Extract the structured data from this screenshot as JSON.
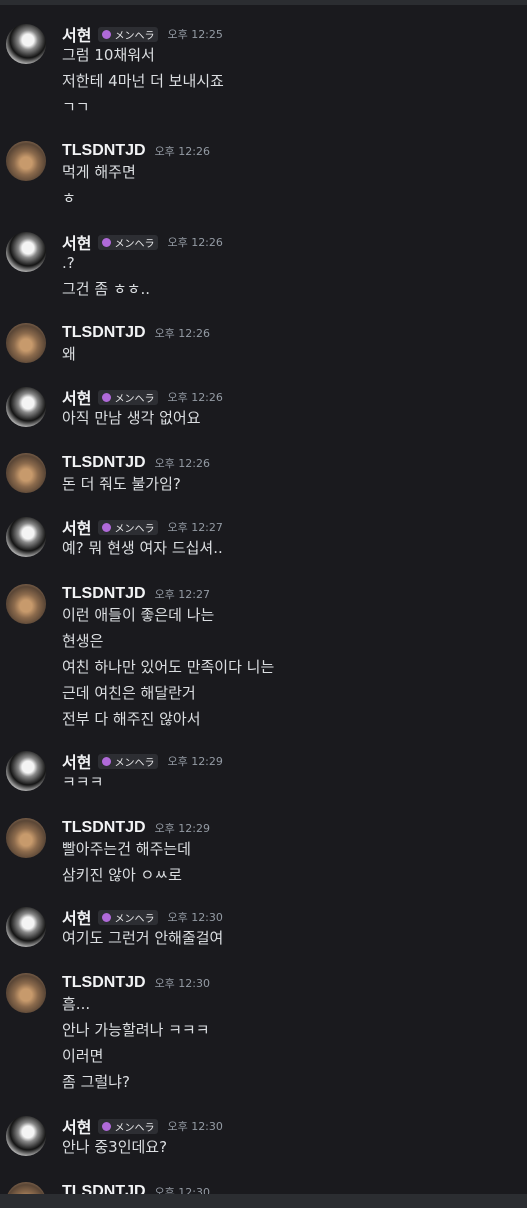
{
  "messages": [
    {
      "author": "서현",
      "tag": "メンヘラ",
      "time": "오후 12:25",
      "lines": [
        "그럼 10채워서",
        "저한테 4마넌 더 보내시죠",
        "ㄱㄱ"
      ]
    },
    {
      "author": "TLSDNTJD",
      "time": "오후 12:26",
      "lines": [
        "먹게 해주면",
        "ㅎ"
      ]
    },
    {
      "author": "서현",
      "tag": "メンヘラ",
      "time": "오후 12:26",
      "lines": [
        ".?",
        "그건 좀 ㅎㅎ.."
      ]
    },
    {
      "author": "TLSDNTJD",
      "time": "오후 12:26",
      "lines": [
        "왜"
      ]
    },
    {
      "author": "서현",
      "tag": "メンヘラ",
      "time": "오후 12:26",
      "lines": [
        "아직 만남 생각 없어요"
      ]
    },
    {
      "author": "TLSDNTJD",
      "time": "오후 12:26",
      "lines": [
        "돈 더 줘도 불가임?"
      ]
    },
    {
      "author": "서현",
      "tag": "メンヘラ",
      "time": "오후 12:27",
      "lines": [
        "예? 뭐 현생 여자 드십셔.."
      ]
    },
    {
      "author": "TLSDNTJD",
      "time": "오후 12:27",
      "lines": [
        "이런 애들이 좋은데 나는",
        "현생은",
        "여친 하나만 있어도 만족이다 니는",
        "근데 여친은 해달란거",
        "전부 다 해주진 않아서"
      ]
    },
    {
      "author": "서현",
      "tag": "メンヘラ",
      "time": "오후 12:29",
      "lines": [
        "ㅋㅋㅋ"
      ]
    },
    {
      "author": "TLSDNTJD",
      "time": "오후 12:29",
      "lines": [
        "빨아주는건 해주는데",
        "삼키진 않아 ㅇㅆ로"
      ]
    },
    {
      "author": "서현",
      "tag": "メンヘラ",
      "time": "오후 12:30",
      "lines": [
        "여기도 그런거 안해줄걸여"
      ]
    },
    {
      "author": "TLSDNTJD",
      "time": "오후 12:30",
      "lines": [
        "흠...",
        "안나 가능할려나 ㅋㅋㅋ",
        "이러면",
        "좀 그럴냐?"
      ]
    },
    {
      "author": "서현",
      "tag": "メンヘラ",
      "time": "오후 12:30",
      "lines": [
        "안나 중3인데요?"
      ]
    },
    {
      "author": "TLSDNTJD",
      "time": "오후 12:30",
      "lines": []
    }
  ]
}
